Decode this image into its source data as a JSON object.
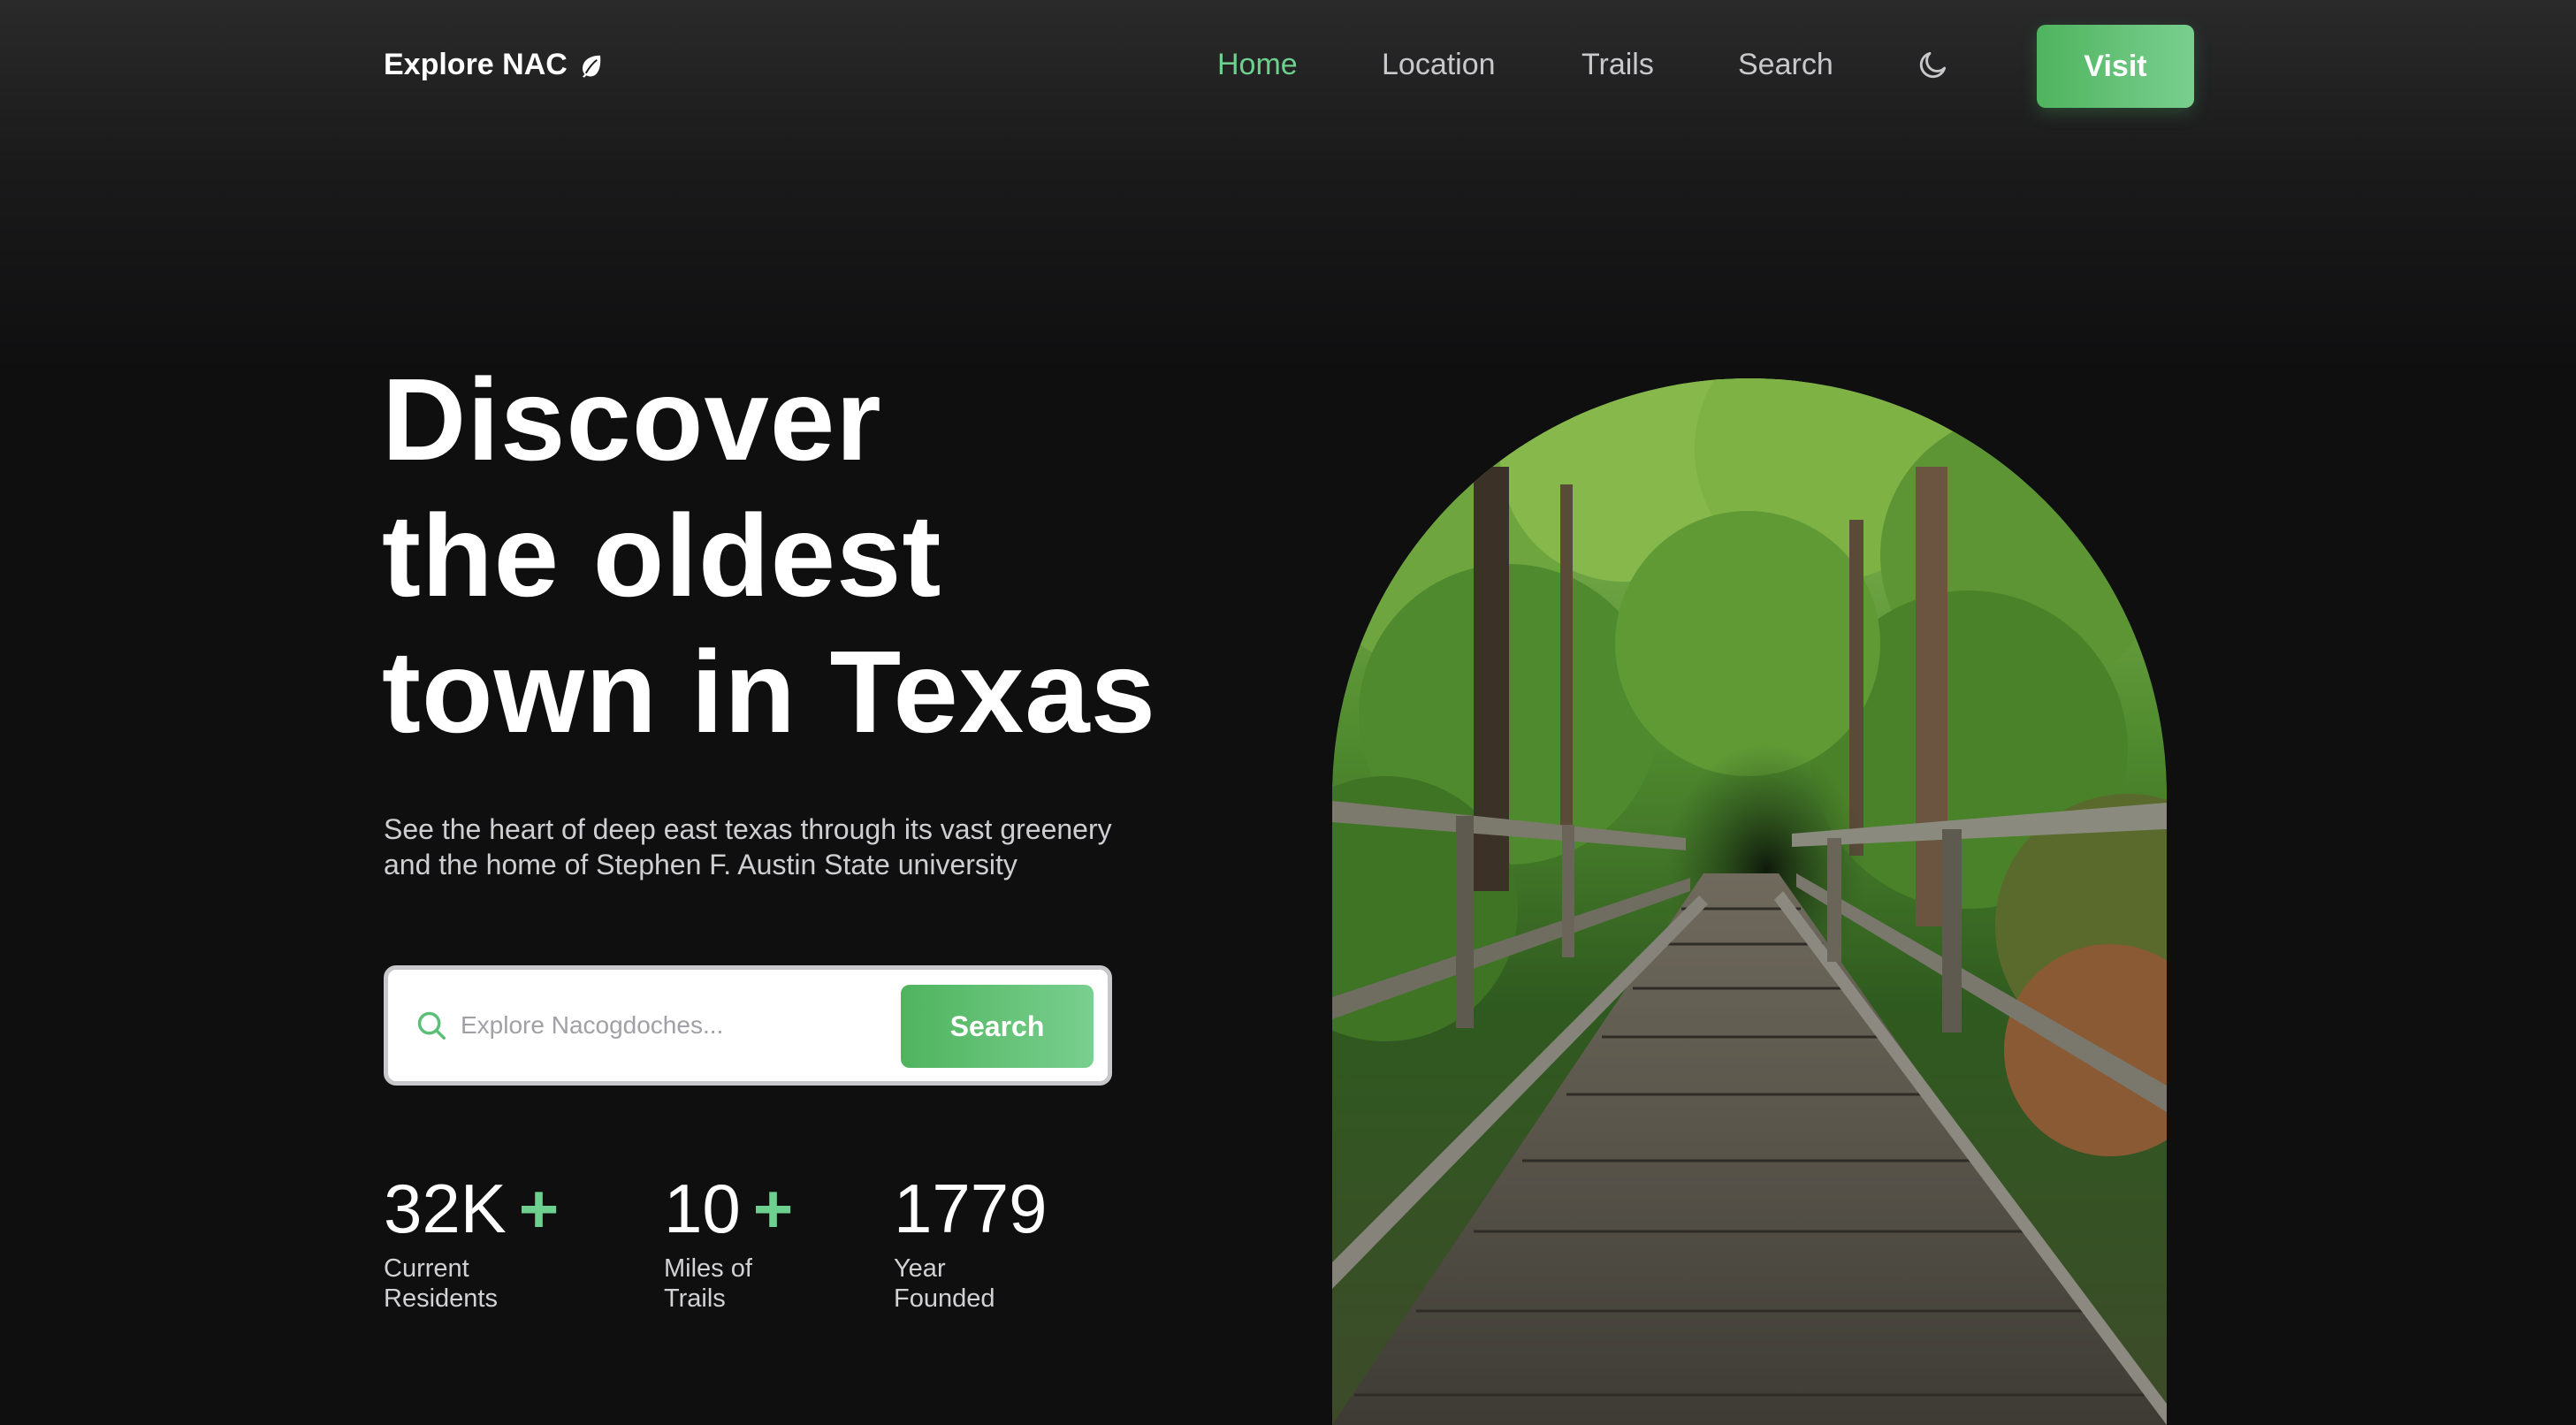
{
  "nav": {
    "logo_text": "Explore NAC",
    "links": [
      {
        "label": "Home",
        "active": true
      },
      {
        "label": "Location"
      },
      {
        "label": "Trails"
      },
      {
        "label": "Search"
      }
    ],
    "theme_toggle_icon": "moon-icon",
    "visit_label": "Visit"
  },
  "hero": {
    "headline": [
      "Discover",
      "the oldest",
      "town in Texas"
    ],
    "subtitle_line1": "See the heart of deep east texas through its vast greenery",
    "subtitle_line2": "and the home of Stephen F. Austin State university",
    "search": {
      "placeholder": "Explore Nacogdoches...",
      "button_label": "Search",
      "icon": "search-icon"
    },
    "stats": [
      {
        "value": "32K",
        "plus": "+",
        "label_line1": "Current",
        "label_line2": "Residents"
      },
      {
        "value": "10",
        "plus": "+",
        "label_line1": "Miles of",
        "label_line2": "Trails"
      },
      {
        "value": "1779",
        "plus": "",
        "label_line1": "Year",
        "label_line2": "Founded"
      }
    ]
  },
  "colors": {
    "accent": "#6dd08f",
    "button_start": "#4fb45e",
    "button_end": "#79cf8f",
    "background": "#0f0f10"
  },
  "image": {
    "subject": "wooden boardwalk trail bridge through green forest"
  }
}
